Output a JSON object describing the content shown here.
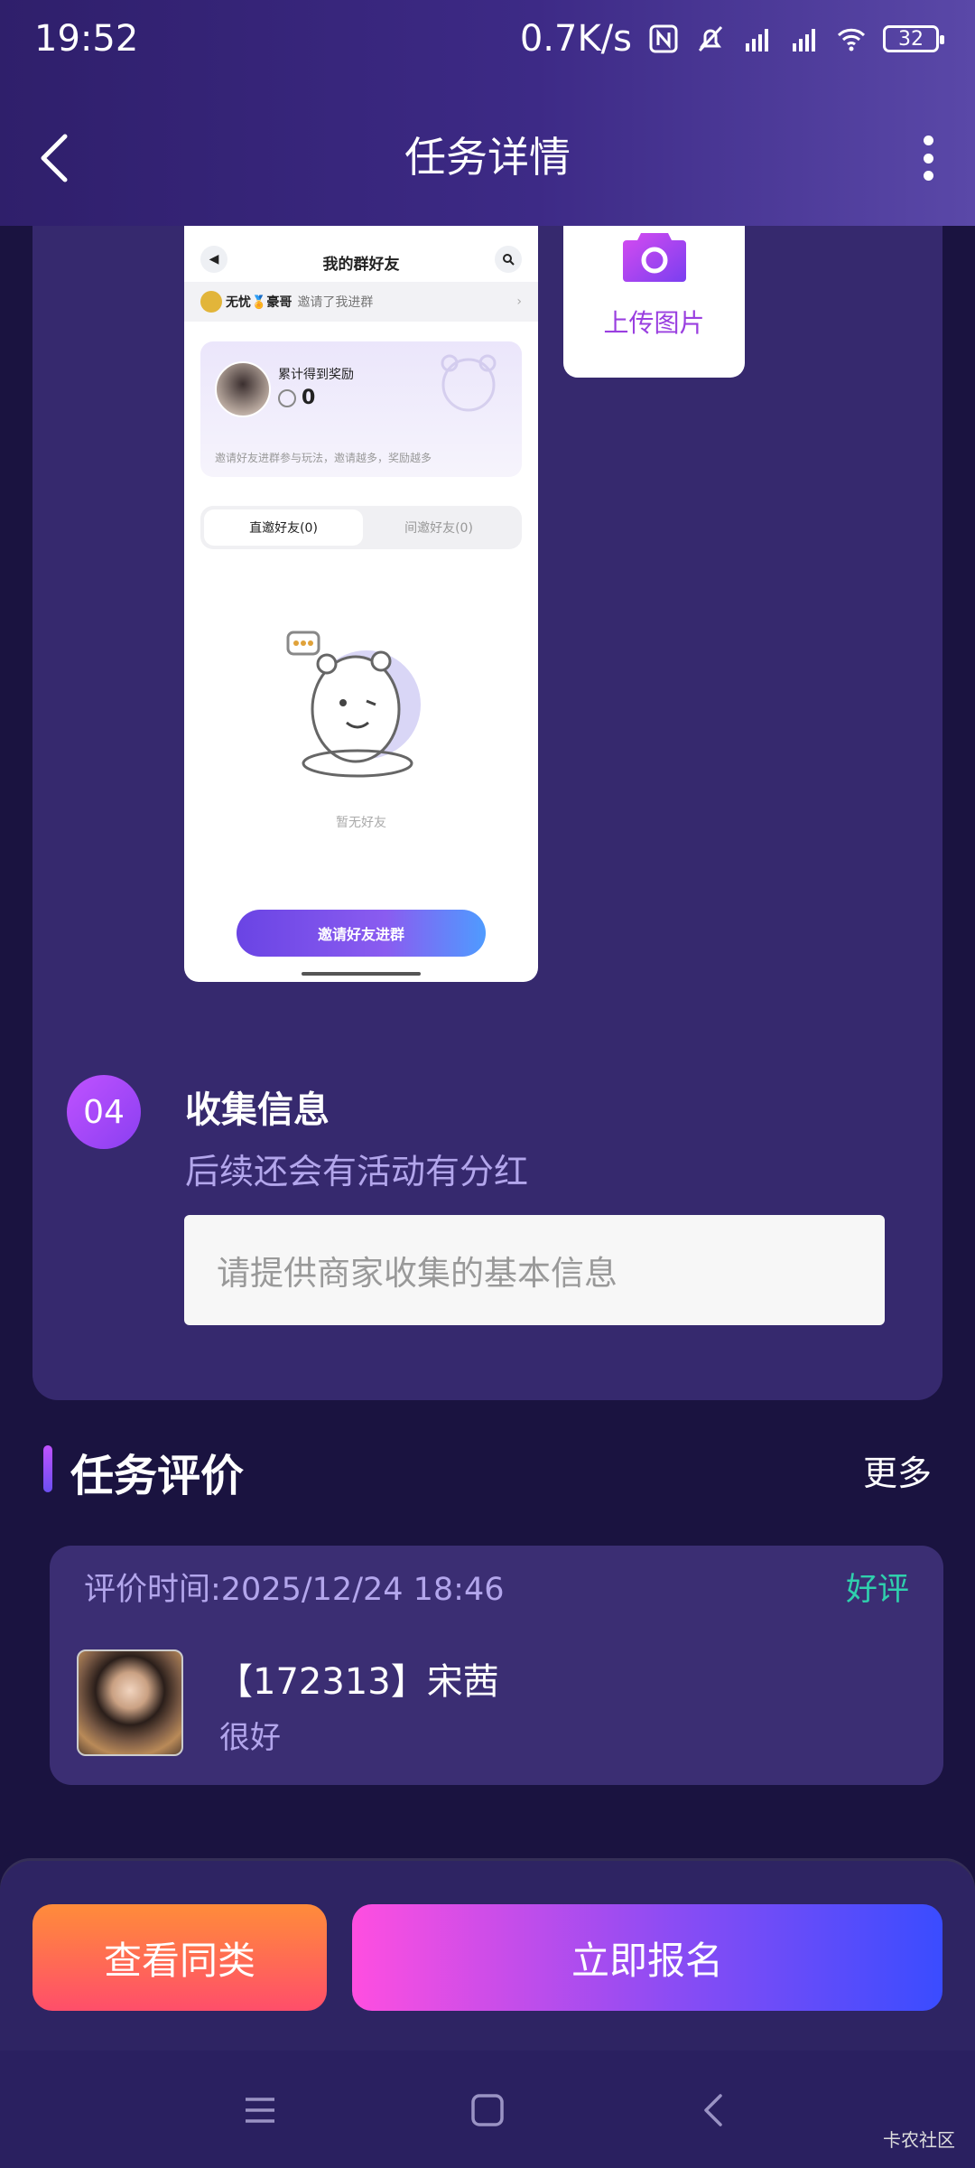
{
  "status_bar": {
    "time": "19:52",
    "net_speed": "0.7K/s",
    "battery": "32"
  },
  "header": {
    "title": "任务详情"
  },
  "step": {
    "screenshot": {
      "title": "我的群好友",
      "notice_name": "无忧🏅豪哥",
      "notice_text": "邀请了我进群",
      "reward_label": "累计得到奖励",
      "reward_value": "0",
      "reward_desc": "邀请好友进群参与玩法，邀请越多，奖励越多",
      "tab_direct": "直邀好友(0)",
      "tab_indirect": "间邀好友(0)",
      "empty_text": "暂无好友",
      "invite_button": "邀请好友进群"
    },
    "upload_label": "上传图片",
    "number": "04",
    "title": "收集信息",
    "description": "后续还会有活动有分红",
    "input_placeholder": "请提供商家收集的基本信息"
  },
  "reviews": {
    "title": "任务评价",
    "more": "更多",
    "items": [
      {
        "time": "评价时间:2025/12/24 18:46",
        "rating": "好评",
        "name": "【172313】宋茜",
        "text": "很好"
      }
    ]
  },
  "bottom": {
    "similar_button": "查看同类",
    "signup_button": "立即报名"
  },
  "watermark": "卡农社区",
  "colors": {
    "accent": "#9a3fe0",
    "good_review": "#2fd0ad",
    "background": "#1a1340"
  }
}
